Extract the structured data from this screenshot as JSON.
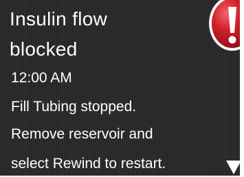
{
  "alert": {
    "title_line1": "Insulin flow",
    "title_line2": "blocked",
    "time": "12:00 AM",
    "message_line1": "Fill Tubing stopped.",
    "message_line2": "Remove reservoir and",
    "message_line3": "select Rewind to restart."
  },
  "icons": {
    "alert": "exclamation-alert-icon",
    "scroll": "scroll-down-arrow-icon"
  },
  "colors": {
    "background": "#2a2a2a",
    "text": "#ffffff",
    "alert_red": "#d0202a"
  }
}
